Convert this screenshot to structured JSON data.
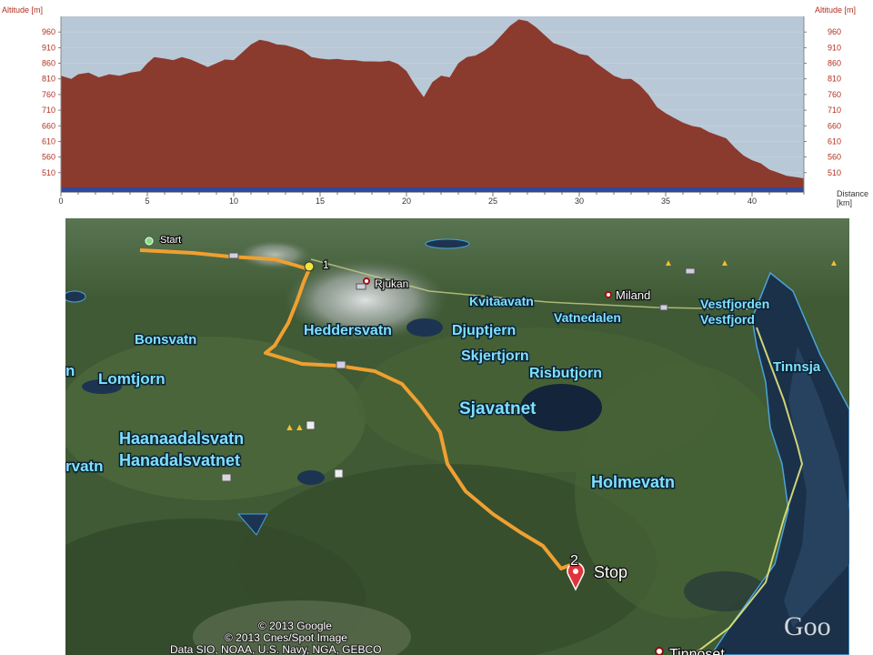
{
  "chart_data": {
    "type": "area",
    "ylabel_left": "Altitude [m]",
    "ylabel_right": "Altitude [m]",
    "xlabel": "Distance [km]",
    "xlabel_line1": "Distance",
    "xlabel_line2": "[km]",
    "xlim": [
      0,
      43
    ],
    "ylim": [
      460,
      1010
    ],
    "y_ticks": [
      510,
      560,
      610,
      660,
      710,
      760,
      810,
      860,
      910,
      960
    ],
    "x_ticks": [
      0,
      5,
      10,
      15,
      20,
      25,
      30,
      35,
      40
    ],
    "fill_color": "#8b3a2e",
    "sky_color": "#b7c7d6",
    "x": [
      0,
      0.6,
      1.0,
      1.6,
      2.2,
      2.8,
      3.4,
      4.0,
      4.6,
      5.0,
      5.4,
      6.0,
      6.5,
      7.0,
      7.5,
      8.0,
      8.5,
      9.0,
      9.5,
      10.0,
      10.5,
      11.0,
      11.5,
      12.0,
      12.5,
      13.0,
      13.5,
      14.0,
      14.5,
      15.0,
      15.5,
      16.0,
      16.5,
      17.0,
      17.5,
      18.0,
      18.5,
      19.0,
      19.5,
      20.0,
      20.5,
      21.0,
      21.5,
      22.0,
      22.5,
      23.0,
      23.5,
      24.0,
      24.5,
      25.0,
      25.5,
      26.0,
      26.5,
      27.0,
      27.5,
      28.0,
      28.5,
      29.0,
      29.5,
      30.0,
      30.5,
      31.0,
      31.5,
      32.0,
      32.5,
      33.0,
      33.5,
      34.0,
      34.5,
      35.0,
      35.5,
      36.0,
      36.5,
      37.0,
      37.5,
      38.0,
      38.5,
      39.0,
      39.5,
      40.0,
      40.5,
      41.0,
      41.5,
      42.0,
      42.5,
      43.0
    ],
    "y": [
      820,
      810,
      825,
      830,
      815,
      825,
      820,
      830,
      835,
      860,
      880,
      875,
      870,
      880,
      872,
      860,
      848,
      860,
      872,
      870,
      895,
      920,
      935,
      930,
      920,
      918,
      910,
      900,
      880,
      875,
      872,
      874,
      870,
      870,
      866,
      866,
      865,
      868,
      858,
      835,
      790,
      752,
      800,
      820,
      815,
      860,
      880,
      885,
      900,
      920,
      950,
      980,
      1000,
      995,
      975,
      950,
      925,
      915,
      905,
      890,
      885,
      860,
      840,
      820,
      810,
      810,
      790,
      760,
      720,
      700,
      685,
      670,
      660,
      655,
      640,
      630,
      620,
      590,
      565,
      550,
      540,
      520,
      510,
      500,
      496,
      492
    ]
  },
  "map": {
    "labels": {
      "start": "Start",
      "waypoint1": "1",
      "rjukan": "Rjukan",
      "kvitaavatn": "Kvitaavatn",
      "miland": "Miland",
      "vestfjorden": "Vestfjorden",
      "vestfjord": "Vestfjord",
      "heddersvatn": "Heddersvatn",
      "djuptjern": "Djuptjern",
      "vatnedalen": "Vatnedalen",
      "bonsvatn": "Bonsvatn",
      "skjertjorn": "Skjertjorn",
      "risbutjorn": "Risbutjorn",
      "tinnsja": "Tinnsja",
      "lomtjorn": "Lomtjorn",
      "lomtjorn_prefix": "n",
      "sjavatnet": "Sjavatnet",
      "haanaadalsvatn": "Haanaadalsvatn",
      "hanadalsvatnet": "Hanadalsvatnet",
      "rvatn": "rvatn",
      "holmevatn": "Holmevatn",
      "waypoint2": "2",
      "stop": "Stop",
      "tinnoset_partial": "Tinnoset",
      "copyright1": "© 2013 Google",
      "copyright2": "© 2013 Cnes/Spot Image",
      "copyright3": "Data SIO, NOAA, U.S. Navy, NGA, GEBCO",
      "logo_partial": "Goo"
    },
    "colors": {
      "terrain": "#3f5a34",
      "water": "#1a3350",
      "track": "#f0a030",
      "water_label": "#7fe0ff",
      "stop_marker": "#e0343a",
      "waypoint_marker": "#f2e63a",
      "start_marker": "#7ee07e"
    }
  }
}
